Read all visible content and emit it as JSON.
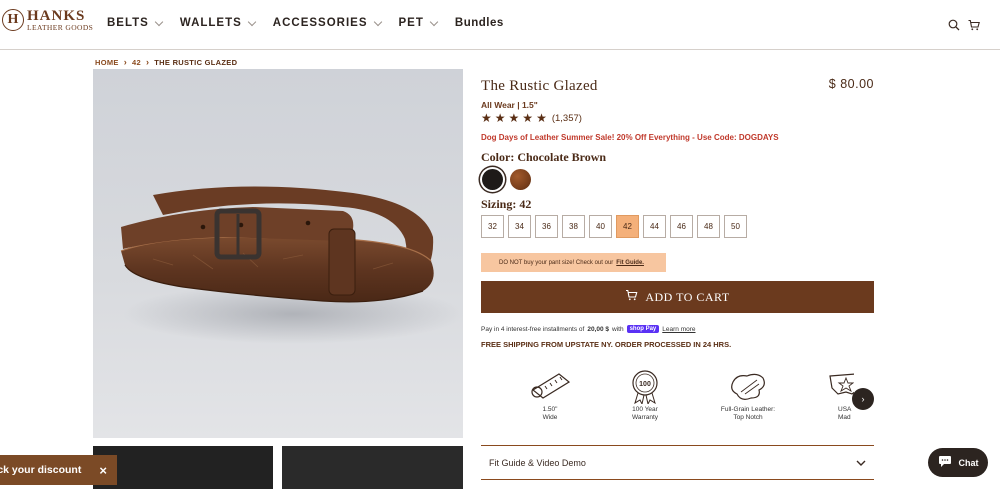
{
  "brand": {
    "name": "HANKS",
    "sub": "LEATHER GOODS",
    "mark": "H"
  },
  "nav": [
    {
      "label": "BELTS",
      "dropdown": true
    },
    {
      "label": "WALLETS",
      "dropdown": true
    },
    {
      "label": "ACCESSORIES",
      "dropdown": true
    },
    {
      "label": "PET",
      "dropdown": true
    },
    {
      "label": "Bundles",
      "dropdown": false
    }
  ],
  "breadcrumb": {
    "home": "HOME",
    "size": "42",
    "current": "THE RUSTIC GLAZED"
  },
  "product": {
    "title": "The Rustic Glazed",
    "price": "$ 80.00",
    "subtitle": "All Wear | 1.5\"",
    "rating_stars": 5,
    "rating_count": "(1,357)",
    "promo": "Dog Days of Leather Summer Sale! 20% Off Everything - Use Code: DOGDAYS",
    "color_prefix": "Color:",
    "color_value": "Chocolate Brown",
    "sizing_prefix": "Sizing:",
    "sizing_value": "42",
    "sizes": [
      "32",
      "34",
      "36",
      "38",
      "40",
      "42",
      "44",
      "46",
      "48",
      "50"
    ],
    "selected_size": "42",
    "warning_text": "DO NOT buy your pant size!  Check out our",
    "warning_link": "Fit Guide.",
    "add_to_cart": "ADD TO CART",
    "pay_text": "Pay in 4 interest-free installments of",
    "pay_amount": "20,00 $",
    "pay_with": "with",
    "shop_pay": "shop Pay",
    "learn_more": "Learn more",
    "shipping": "FREE SHIPPING FROM UPSTATE NY. ORDER PROCESSED IN 24 HRS."
  },
  "features": [
    {
      "line1": "1.50\"",
      "line2": "Wide",
      "icon": "ruler-leather-icon"
    },
    {
      "line1": "100 Year",
      "line2": "Warranty",
      "icon": "warranty-seal-icon"
    },
    {
      "line1": "Full-Grain Leather:",
      "line2": "Top Notch",
      "icon": "leather-hide-icon"
    },
    {
      "line1": "USA",
      "line2": "Mad",
      "icon": "usa-map-icon"
    }
  ],
  "accordion": {
    "label": "Fit Guide & Video Demo"
  },
  "discount": {
    "label": "lock your discount",
    "close": "×"
  },
  "chat": {
    "label": "Chat"
  },
  "colors": {
    "brand_brown": "#6b3a1e",
    "promo_red": "#c0392b",
    "size_selected": "#f4b07a",
    "warning_bg": "#f7c6a0"
  }
}
